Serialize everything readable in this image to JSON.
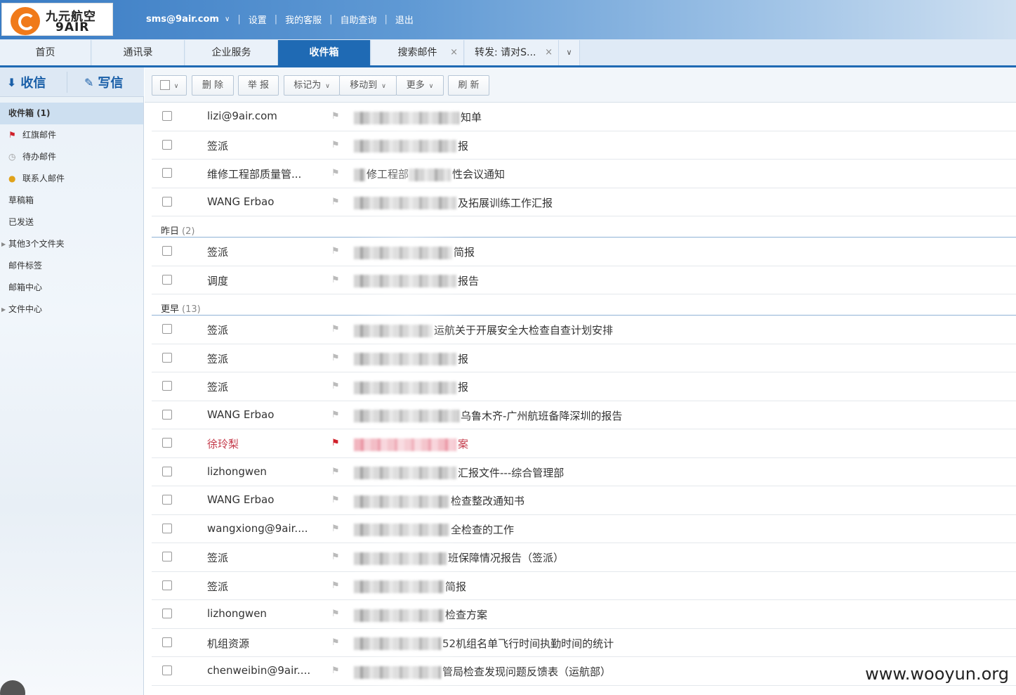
{
  "header": {
    "logo_cn": "九元航空",
    "logo_en": "9AIR",
    "account": "sms@9air.com",
    "nav": [
      "设置",
      "我的客服",
      "自助查询",
      "退出"
    ]
  },
  "tabs": [
    {
      "label": "首页",
      "active": false,
      "closable": false
    },
    {
      "label": "通讯录",
      "active": false,
      "closable": false
    },
    {
      "label": "企业服务",
      "active": false,
      "closable": false
    },
    {
      "label": "收件箱",
      "active": true,
      "closable": false
    },
    {
      "label": "搜索邮件",
      "active": false,
      "closable": true
    },
    {
      "label": "转发: 请对S...",
      "active": false,
      "closable": true
    }
  ],
  "sidebar": {
    "receive": "收信",
    "compose": "写信",
    "folders": [
      {
        "label": "收件箱 (1)",
        "icon": "inbox",
        "selected": true
      },
      {
        "label": "红旗邮件",
        "icon": "red-flag-icon"
      },
      {
        "label": "待办邮件",
        "icon": "clock-icon"
      },
      {
        "label": "联系人邮件",
        "icon": "person-icon"
      },
      {
        "label": "草稿箱",
        "icon": ""
      },
      {
        "label": "已发送",
        "icon": ""
      },
      {
        "label": "其他3个文件夹",
        "icon": "",
        "expandable": true
      },
      {
        "label": "邮件标签",
        "icon": ""
      },
      {
        "label": "邮箱中心",
        "icon": ""
      },
      {
        "label": "文件中心",
        "icon": "",
        "expandable": true
      }
    ]
  },
  "toolbar": {
    "delete": "删 除",
    "report": "举 报",
    "mark_as": "标记为",
    "move_to": "移动到",
    "more": "更多",
    "refresh": "刷 新"
  },
  "groups": [
    {
      "label": "",
      "count": "",
      "rows": [
        {
          "from": "lizi@9air.com",
          "subject": "知单",
          "blur_w": 150
        },
        {
          "from": "签派",
          "subject": "报",
          "blur_w": 146
        },
        {
          "from": "维修工程部质量管...",
          "subject": "修工程部",
          "tail": "性会议通知",
          "blur_w": 16,
          "blur_mid": 60
        },
        {
          "from": "WANG Erbao",
          "subject": "及拓展训练工作汇报",
          "blur_w": 146
        }
      ]
    },
    {
      "label": "昨日",
      "count": "(2)",
      "rows": [
        {
          "from": "签派",
          "subject": "简报",
          "blur_w": 140
        },
        {
          "from": "调度",
          "subject": "报告",
          "blur_w": 146
        }
      ]
    },
    {
      "label": "更早",
      "count": "(13)",
      "rows": [
        {
          "from": "签派",
          "subject": "运航关于开展安全大检查自查计划安排",
          "blur_w": 112
        },
        {
          "from": "签派",
          "subject": "报",
          "blur_w": 146
        },
        {
          "from": "签派",
          "subject": "报",
          "blur_w": 146
        },
        {
          "from": "WANG Erbao",
          "subject": "乌鲁木齐-广州航班备降深圳的报告",
          "blur_w": 150
        },
        {
          "from": "徐玲梨",
          "subject": "案",
          "blur_w": 146,
          "flagged": true
        },
        {
          "from": "lizhongwen",
          "subject": "汇报文件---综合管理部",
          "blur_w": 146
        },
        {
          "from": "WANG Erbao",
          "subject": "检查整改通知书",
          "blur_w": 136
        },
        {
          "from": "wangxiong@9air....",
          "subject": "全检查的工作",
          "blur_w": 136
        },
        {
          "from": "签派",
          "subject": "班保障情况报告（签派）",
          "blur_w": 132
        },
        {
          "from": "签派",
          "subject": "简报",
          "blur_w": 128
        },
        {
          "from": "lizhongwen",
          "subject": "检查方案",
          "blur_w": 128
        },
        {
          "from": "机组资源",
          "subject": "52机组名单飞行时间执勤时间的统计",
          "blur_w": 124
        },
        {
          "from": "chenweibin@9air....",
          "subject": "管局检查发现问题反馈表（运航部）",
          "blur_w": 124
        }
      ]
    }
  ],
  "watermark": "www.wooyun.org",
  "colors": {
    "accent": "#1f6ab4",
    "flag": "#d0202a",
    "flag_text": "#c43a4a"
  }
}
